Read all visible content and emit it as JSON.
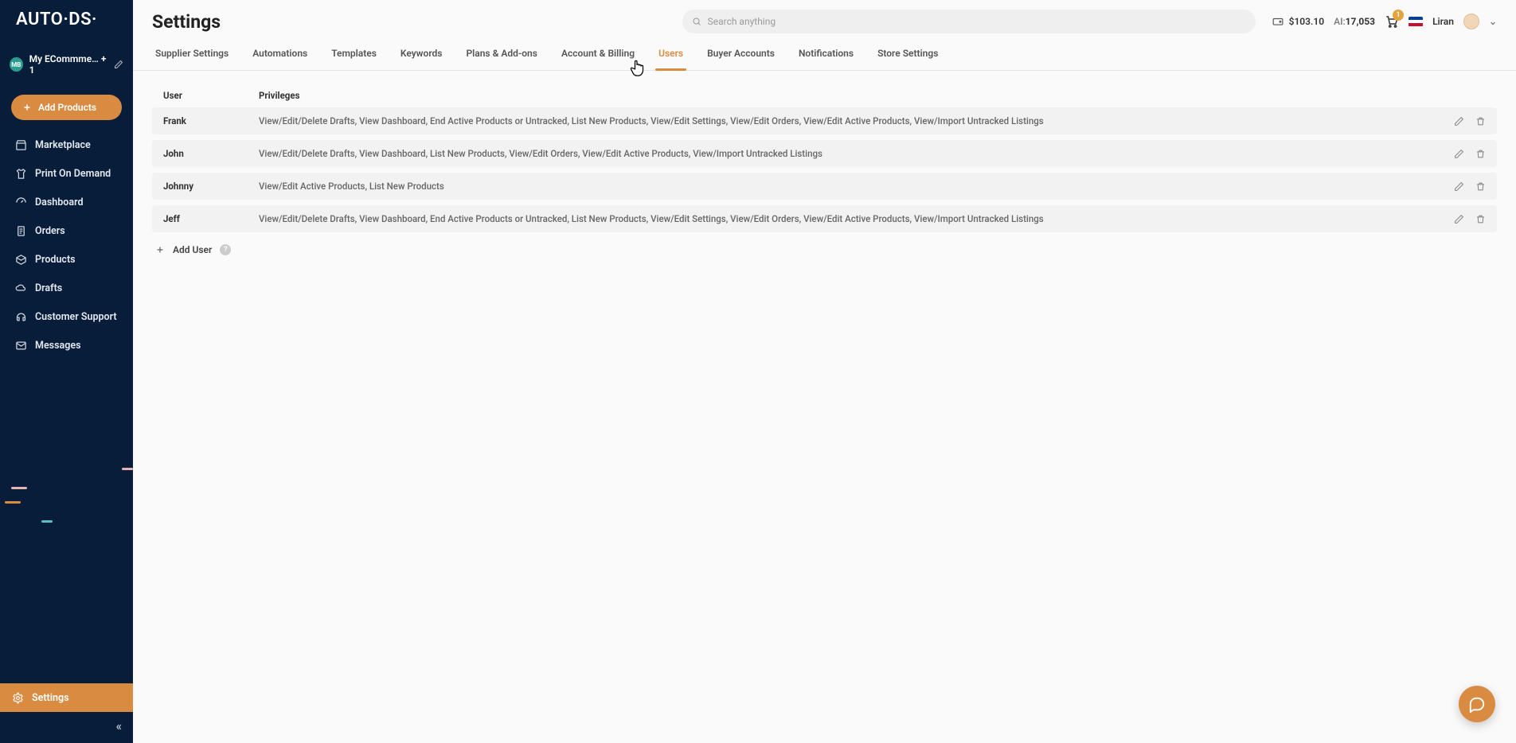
{
  "brand": "AUTO·DS·",
  "store": {
    "badge": "MB",
    "name": "My ECommme… + 1"
  },
  "sidebar": {
    "add_products": "Add Products",
    "items": [
      {
        "label": "Marketplace"
      },
      {
        "label": "Print On Demand"
      },
      {
        "label": "Dashboard"
      },
      {
        "label": "Orders"
      },
      {
        "label": "Products"
      },
      {
        "label": "Drafts"
      },
      {
        "label": "Customer Support"
      },
      {
        "label": "Messages"
      }
    ],
    "settings": "Settings"
  },
  "header": {
    "title": "Settings",
    "search_placeholder": "Search anything",
    "wallet": "$103.10",
    "ai_label": "AI:",
    "ai_value": "17,053",
    "cart_badge": "1",
    "user_name": "Liran"
  },
  "tabs": [
    "Supplier Settings",
    "Automations",
    "Templates",
    "Keywords",
    "Plans & Add-ons",
    "Account & Billing",
    "Users",
    "Buyer Accounts",
    "Notifications",
    "Store Settings"
  ],
  "active_tab": "Users",
  "table": {
    "headers": {
      "user": "User",
      "privileges": "Privileges"
    },
    "rows": [
      {
        "user": "Frank",
        "privileges": "View/Edit/Delete Drafts, View Dashboard, End Active Products or Untracked, List New Products, View/Edit Settings, View/Edit Orders, View/Edit Active Products, View/Import Untracked Listings"
      },
      {
        "user": "John",
        "privileges": "View/Edit/Delete Drafts, View Dashboard, List New Products, View/Edit Orders, View/Edit Active Products, View/Import Untracked Listings"
      },
      {
        "user": "Johnny",
        "privileges": "View/Edit Active Products, List New Products"
      },
      {
        "user": "Jeff",
        "privileges": "View/Edit/Delete Drafts, View Dashboard, End Active Products or Untracked, List New Products, View/Edit Settings, View/Edit Orders, View/Edit Active Products, View/Import Untracked Listings"
      }
    ],
    "add_user": "Add User"
  }
}
